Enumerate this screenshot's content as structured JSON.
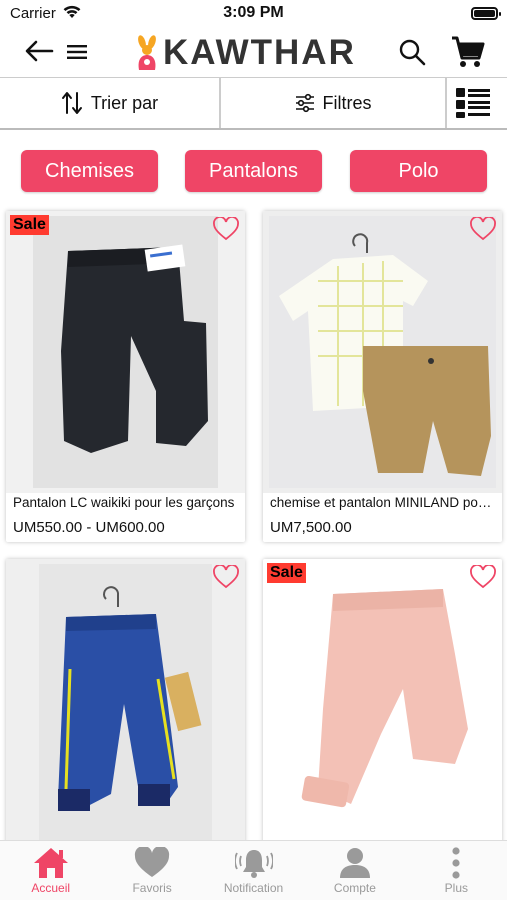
{
  "status_bar": {
    "carrier": "Carrier",
    "time": "3:09 PM"
  },
  "header": {
    "brand": "KAWTHAR"
  },
  "toolbar": {
    "sort_label": "Trier par",
    "filter_label": "Filtres"
  },
  "categories": [
    "Chemises",
    "Pantalons",
    "Polo"
  ],
  "products": [
    {
      "title": "Pantalon LC waikiki pour les garçons",
      "price": "UM550.00 - UM600.00",
      "sale": "Sale"
    },
    {
      "title": "chemise et pantalon MINILAND pour les garçons",
      "price": "UM7,500.00",
      "sale": ""
    },
    {
      "title": "",
      "price": "",
      "sale": ""
    },
    {
      "title": "",
      "price": "",
      "sale": "Sale"
    }
  ],
  "tabs": [
    {
      "label": "Accueil",
      "icon": "home-icon",
      "active": true
    },
    {
      "label": "Favoris",
      "icon": "heart-icon",
      "active": false
    },
    {
      "label": "Notification",
      "icon": "bell-icon",
      "active": false
    },
    {
      "label": "Compte",
      "icon": "user-icon",
      "active": false
    },
    {
      "label": "Plus",
      "icon": "more-icon",
      "active": false
    }
  ],
  "colors": {
    "accent": "#ef4566",
    "sale_badge": "#ff3b30",
    "tab_inactive": "#9a9a9a"
  }
}
